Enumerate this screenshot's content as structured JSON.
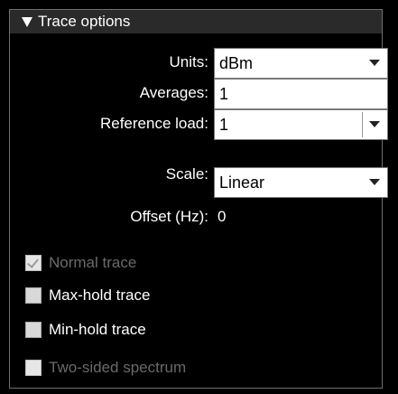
{
  "panel": {
    "title": "Trace options"
  },
  "fields": {
    "units": {
      "label": "Units:",
      "value": "dBm"
    },
    "averages": {
      "label": "Averages:",
      "value": "1"
    },
    "reference_load": {
      "label": "Reference load:",
      "value": "1"
    },
    "scale": {
      "label": "Scale:",
      "value": "Linear"
    },
    "offset": {
      "label": "Offset (Hz):",
      "value": "0"
    }
  },
  "checkboxes": {
    "normal_trace": {
      "label": "Normal trace",
      "checked": true,
      "enabled": false
    },
    "max_hold_trace": {
      "label": "Max-hold trace",
      "checked": false,
      "enabled": true
    },
    "min_hold_trace": {
      "label": "Min-hold trace",
      "checked": false,
      "enabled": true
    },
    "two_sided_spectrum": {
      "label": "Two-sided spectrum",
      "checked": false,
      "enabled": false
    }
  },
  "colors": {
    "background": "#000000",
    "header": "#2a2a2a",
    "text": "#ffffff",
    "disabled_text": "#6a6a6a"
  }
}
